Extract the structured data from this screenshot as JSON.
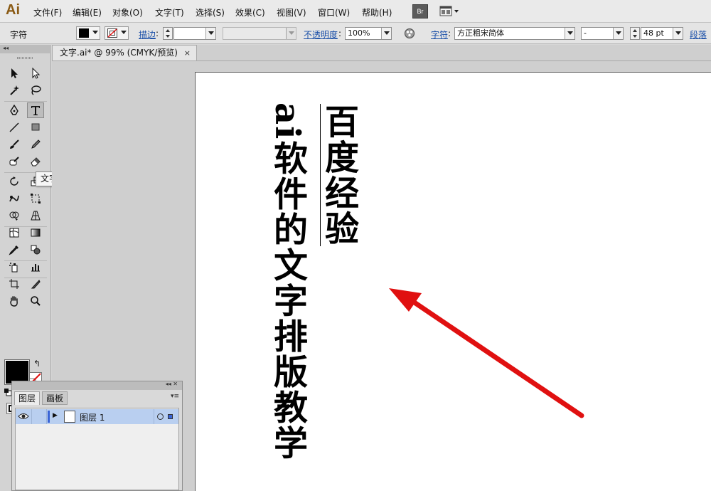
{
  "app": {
    "logo": "Ai"
  },
  "menu": [
    "文件(F)",
    "编辑(E)",
    "对象(O)",
    "文字(T)",
    "选择(S)",
    "效果(C)",
    "视图(V)",
    "窗口(W)",
    "帮助(H)"
  ],
  "menubar_buttons": {
    "bridge": "Br",
    "bridge_icon": "bridge-icon",
    "workspace_icon": "workspace-switcher-icon"
  },
  "control_bar": {
    "mode_label": "字符",
    "stroke_label": "描边",
    "opacity_label": "不透明度",
    "opacity_value": "100%",
    "character_label": "字符",
    "font_family": "方正粗宋简体",
    "font_style": "-",
    "font_size": "48 pt",
    "paragraph_label": "段落"
  },
  "tools": {
    "header": "◂◂",
    "tooltip": "文字工具 (T)",
    "active": "type-tool",
    "fill_color": "#000000",
    "stroke_color": "none",
    "swap_glyph": "↰"
  },
  "document": {
    "tab_title": "文字.ai* @ 99% (CMYK/预览)",
    "close_glyph": "×",
    "text_column_1_latin": "ai",
    "text_column_1_cjk": "软件的文字排版教学",
    "text_column_2": "百度经验",
    "annotation_arrow_color": "#e01010"
  },
  "layers_panel": {
    "collapse_glyph": "◂◂ ✕",
    "tabs": [
      "图层",
      "画板"
    ],
    "menu_glyph": "▾≡",
    "layers": [
      {
        "name": "图层 1",
        "visible": true,
        "color": "#3a64d6",
        "expand_glyph": "▶"
      }
    ]
  }
}
